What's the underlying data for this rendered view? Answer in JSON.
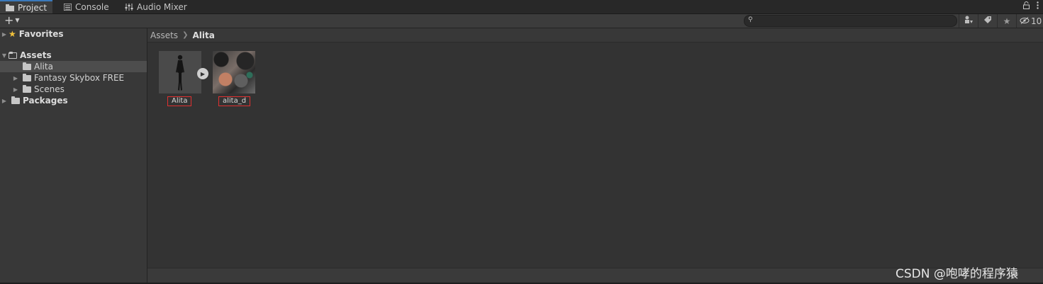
{
  "tabs": [
    {
      "label": "Project",
      "icon": "folder-icon",
      "active": true
    },
    {
      "label": "Console",
      "icon": "console-icon",
      "active": false
    },
    {
      "label": "Audio Mixer",
      "icon": "mixer-icon",
      "active": false
    }
  ],
  "toolbar": {
    "add_icon": "plus-icon",
    "search_placeholder": "",
    "hidden_count": "10"
  },
  "sidebar": {
    "favorites": {
      "label": "Favorites"
    },
    "assets": {
      "label": "Assets"
    },
    "children": [
      {
        "label": "Alita",
        "selected": true
      },
      {
        "label": "Fantasy Skybox FREE",
        "selected": false
      },
      {
        "label": "Scenes",
        "selected": false
      }
    ],
    "packages": {
      "label": "Packages"
    }
  },
  "breadcrumb": {
    "root": "Assets",
    "current": "Alita"
  },
  "assets": [
    {
      "label": "Alita",
      "type": "model"
    },
    {
      "label": "alita_d",
      "type": "texture"
    }
  ],
  "watermark": "CSDN @咆哮的程序猿",
  "colors": {
    "accent": "#3a79bb",
    "highlight_border": "#e03030",
    "favorites_star": "#f2c23c"
  }
}
